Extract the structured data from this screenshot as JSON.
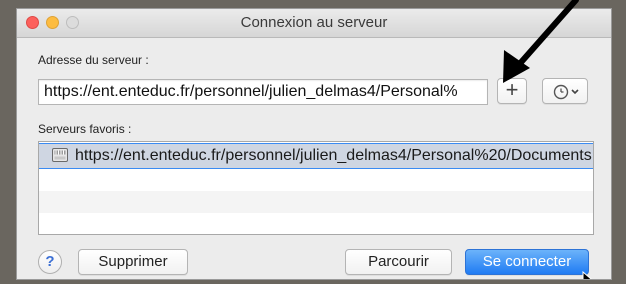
{
  "window": {
    "title": "Connexion au serveur"
  },
  "address": {
    "label": "Adresse du serveur :",
    "value": "https://ent.enteduc.fr/personnel/julien_delmas4/Personal%"
  },
  "toolbar": {
    "add_label": "+",
    "recent_icon": "clock-icon",
    "recent_chevron_icon": "chevron-down-icon"
  },
  "favorites": {
    "label": "Serveurs favoris :",
    "items": [
      {
        "url": "https://ent.enteduc.fr/personnel/julien_delmas4/Personal%20/Documents",
        "icon": "server-icon",
        "selected": true
      }
    ]
  },
  "buttons": {
    "help": "?",
    "remove": "Supprimer",
    "browse": "Parcourir",
    "connect": "Se connecter"
  },
  "colors": {
    "accent": "#1f7bf3",
    "close": "#fc605c",
    "minimize": "#fdbc40",
    "selection_border": "#3b8bf2"
  }
}
